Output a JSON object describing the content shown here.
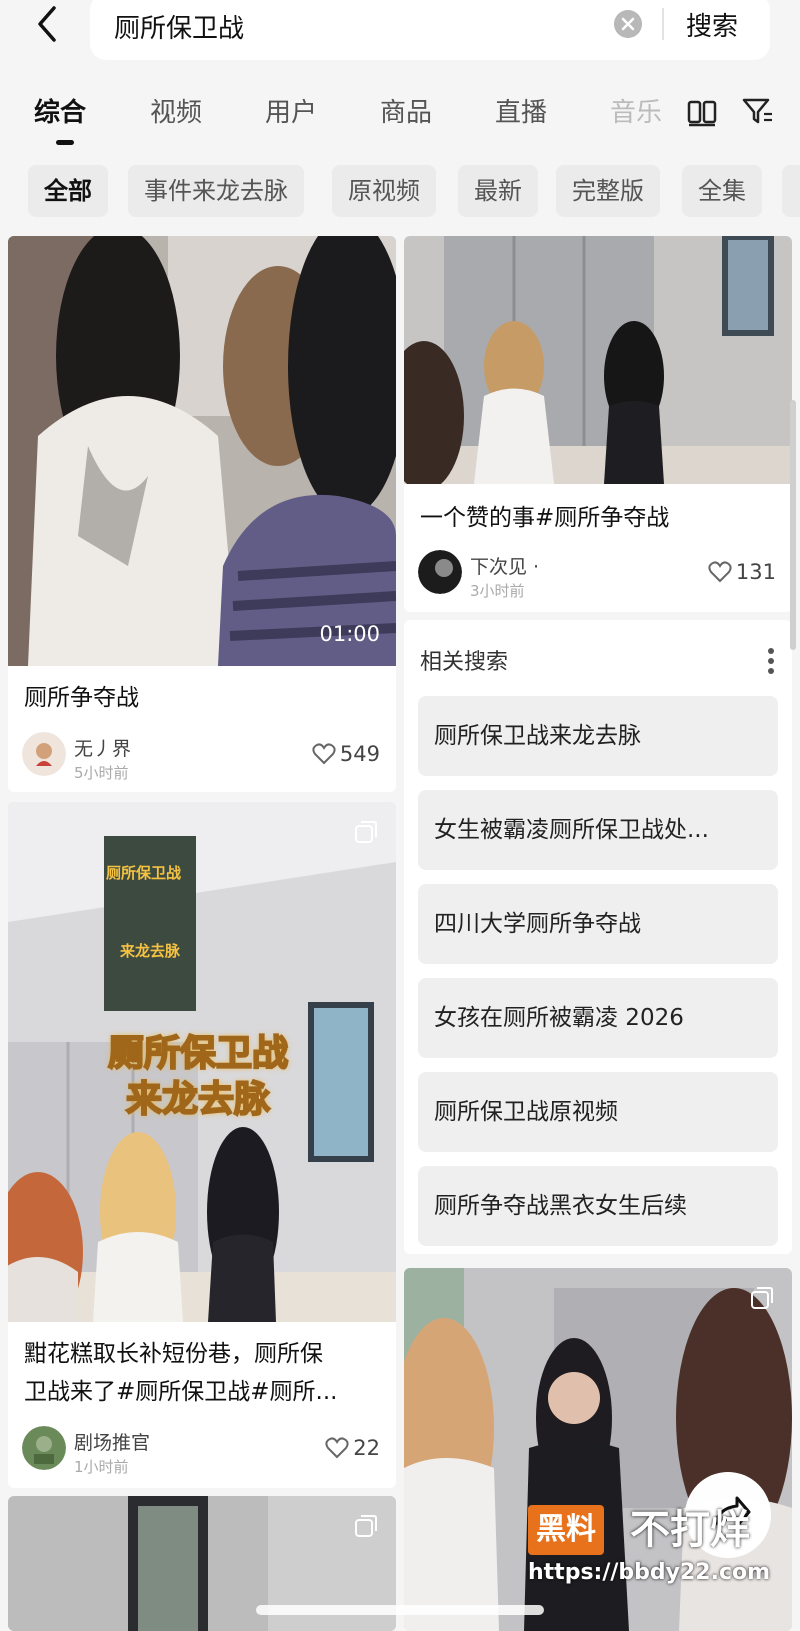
{
  "search": {
    "query": "厕所保卫战",
    "button": "搜索"
  },
  "tabs": [
    "综合",
    "视频",
    "用户",
    "商品",
    "直播",
    "音乐"
  ],
  "chips": [
    "全部",
    "事件来龙去脉",
    "原视频",
    "最新",
    "完整版",
    "全集"
  ],
  "cards": [
    {
      "title": "厕所争夺战",
      "duration": "01:00",
      "author": "无丿界",
      "time": "5小时前",
      "likes": "549"
    },
    {
      "title": "一个赞的事#厕所争夺战",
      "author": "下次见 ·",
      "time": "3小时前",
      "likes": "131"
    },
    {
      "title_line1": "黚花糕取长补短份巷，厕所保",
      "title_line2": "卫战来了#厕所保卫战#厕所...",
      "overlay_line1": "厕所保卫战",
      "overlay_line2": "来龙去脉",
      "inset_title": "厕所保卫战",
      "inset_sub": "来龙去脉",
      "author": "剧场推官",
      "time": "1小时前",
      "likes": "22"
    }
  ],
  "related": {
    "title": "相关搜索",
    "items": [
      "厕所保卫战来龙去脉",
      "女生被霸凌厕所保卫战处...",
      "四川大学厕所争夺战",
      "女孩在厕所被霸凌 2026",
      "厕所保卫战原视频",
      "厕所争夺战黑衣女生后续"
    ]
  },
  "watermark": {
    "logo": "黑料",
    "logo2": "不打烊",
    "url": "https://bbdy22.com"
  },
  "colors": {
    "accent": "#e8711b",
    "background": "#f5f5f5"
  }
}
